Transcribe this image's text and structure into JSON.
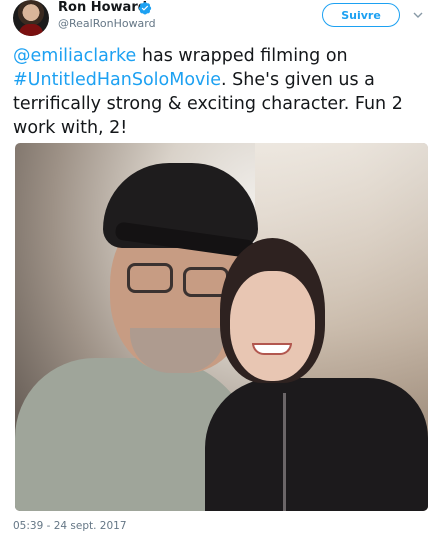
{
  "author": {
    "name": "Ron Howard",
    "handle": "@RealRonHoward",
    "verified_icon": "verified-badge-icon",
    "verified_color": "#1da1f2"
  },
  "follow_button": {
    "label": "Suivre"
  },
  "menu_icon": "chevron-down-icon",
  "tweet": {
    "mention": "@emiliaclarke",
    "text_part1": " has wrapped filming on ",
    "hashtag": "#UntitledHanSoloMovie",
    "text_part2": ". She's given us a terrifically strong & exciting character. Fun 2 work with, 2!"
  },
  "photo": {
    "description": "selfie photo"
  },
  "timestamp": "05:39 - 24 sept. 2017",
  "colors": {
    "link": "#1da1f2",
    "text": "#14171a",
    "secondary": "#657786"
  }
}
